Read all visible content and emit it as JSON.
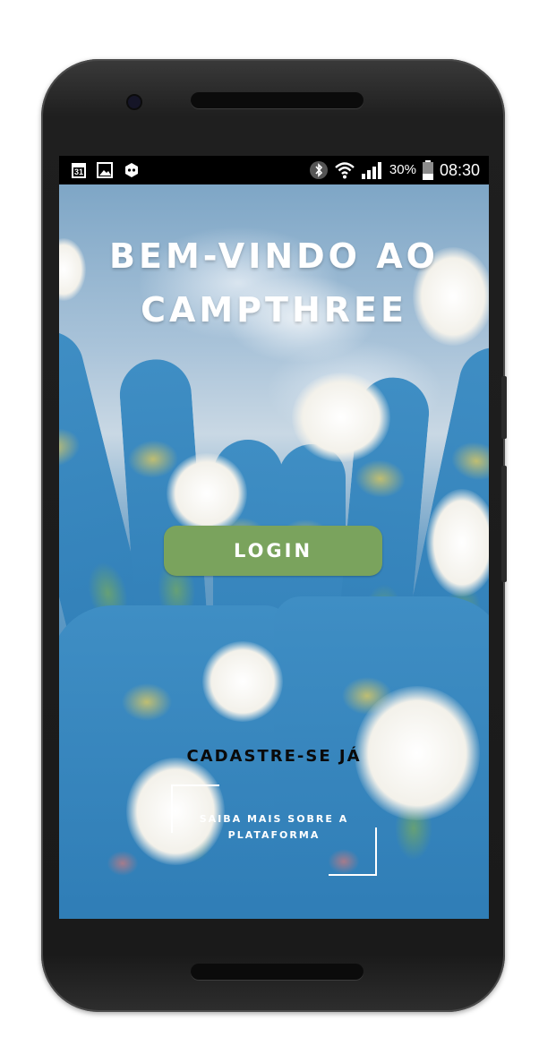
{
  "status_bar": {
    "left_icons": [
      "calendar-icon",
      "image-icon",
      "game-controller-icon"
    ],
    "calendar_day": "31",
    "right_icons": [
      "bluetooth-icon",
      "wifi-icon",
      "signal-icon",
      "battery-icon"
    ],
    "battery": "30%",
    "time": "08:30"
  },
  "app": {
    "title_line1": "BEM-VINDO AO",
    "title_line2": "CAMPTHREE",
    "login_label": "LOGIN",
    "signup_label": "CADASTRE-SE JÁ",
    "more_line1": "SAIBA MAIS SOBRE A",
    "more_line2": "PLATAFORMA"
  },
  "colors": {
    "login_button": "#7aa35d",
    "title_text": "#ffffff",
    "signup_text": "#0a0a0a",
    "status_bar_bg": "#000000"
  }
}
